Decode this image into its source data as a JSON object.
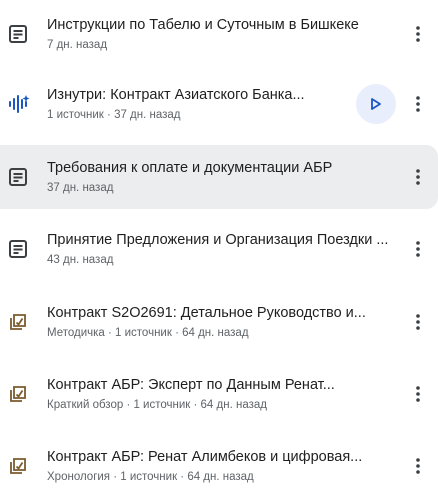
{
  "items": [
    {
      "title": "Инструкции по Табелю и Суточным в Бишкеке",
      "meta": "7 дн. назад",
      "icon": "note-icon"
    },
    {
      "title": "Изнутри: Контракт Азиатского Банка...",
      "meta": "1 источник · 37 дн. назад",
      "icon": "audio-overview-icon",
      "has_play": true
    },
    {
      "title": "Требования к оплате и документации АБР",
      "meta": "37 дн. назад",
      "icon": "note-icon",
      "selected": true
    },
    {
      "title": "Принятие Предложения и Организация Поездки ...",
      "meta": "43 дн. назад",
      "icon": "note-icon"
    },
    {
      "title": "Контракт S2O2691: Детальное Руководство и...",
      "meta": "Методичка · 1 источник · 64 дн. назад",
      "icon": "study-guide-icon"
    },
    {
      "title": "Контракт АБР: Эксперт по Данным Ренат...",
      "meta": "Краткий обзор · 1 источник · 64 дн. назад",
      "icon": "study-guide-icon"
    },
    {
      "title": "Контракт АБР: Ренат Алимбеков и цифровая...",
      "meta": "Хронология · 1 источник · 64 дн. назад",
      "icon": "study-guide-icon"
    }
  ],
  "colors": {
    "icon_dark": "#3c4043",
    "audio_icon": "#1a56c4",
    "study_icon": "#7a5b2e",
    "play_bg": "#e8eefc",
    "selected_bg": "#ebedef"
  }
}
